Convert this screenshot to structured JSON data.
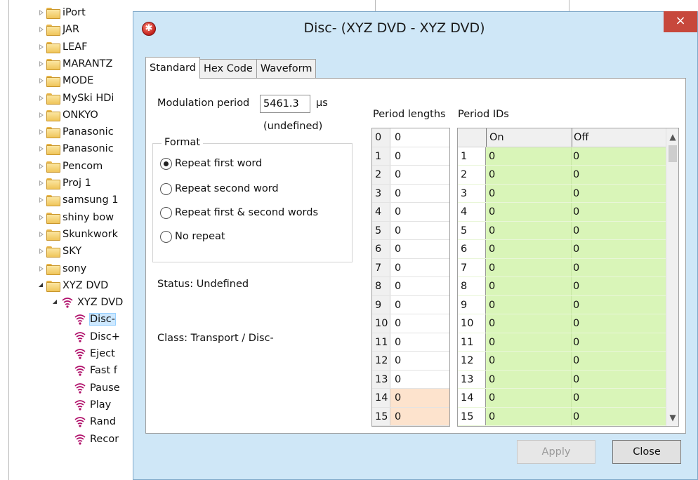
{
  "tree": {
    "items": [
      {
        "label": "iPort"
      },
      {
        "label": "JAR"
      },
      {
        "label": "LEAF"
      },
      {
        "label": "MARANTZ"
      },
      {
        "label": "MODE"
      },
      {
        "label": "MySki HDi"
      },
      {
        "label": "ONKYO"
      },
      {
        "label": "Panasonic"
      },
      {
        "label": "Panasonic"
      },
      {
        "label": "Pencom"
      },
      {
        "label": "Proj 1"
      },
      {
        "label": "samsung 1"
      },
      {
        "label": "shiny bow"
      },
      {
        "label": "Skunkwork"
      },
      {
        "label": "SKY"
      },
      {
        "label": "sony"
      },
      {
        "label": "XYZ DVD"
      },
      {
        "label": "XYZ DVD"
      },
      {
        "label": "Disc-"
      },
      {
        "label": "Disc+"
      },
      {
        "label": "Eject"
      },
      {
        "label": "Fast f"
      },
      {
        "label": "Pause"
      },
      {
        "label": "Play"
      },
      {
        "label": "Rand"
      },
      {
        "label": "Recor"
      }
    ]
  },
  "dialog": {
    "title": "Disc- (XYZ DVD - XYZ DVD)",
    "close_glyph": "×",
    "tabs": [
      {
        "label": "Standard",
        "active": true
      },
      {
        "label": "Hex Code",
        "active": false
      },
      {
        "label": "Waveform",
        "active": false
      }
    ],
    "modulation_label": "Modulation period",
    "modulation_value": "5461.3",
    "modulation_unit": "μs",
    "modulation_status": "(undefined)",
    "format": {
      "legend": "Format",
      "options": [
        {
          "label": "Repeat first word",
          "checked": true
        },
        {
          "label": "Repeat second word",
          "checked": false
        },
        {
          "label": "Repeat first & second words",
          "checked": false
        },
        {
          "label": "No repeat",
          "checked": false
        }
      ]
    },
    "status": "Status: Undefined",
    "class": "Class: Transport / Disc-",
    "period_lengths": {
      "title": "Period lengths",
      "rows": [
        {
          "idx": "0",
          "val": "0"
        },
        {
          "idx": "1",
          "val": "0"
        },
        {
          "idx": "2",
          "val": "0"
        },
        {
          "idx": "3",
          "val": "0"
        },
        {
          "idx": "4",
          "val": "0"
        },
        {
          "idx": "5",
          "val": "0"
        },
        {
          "idx": "6",
          "val": "0"
        },
        {
          "idx": "7",
          "val": "0"
        },
        {
          "idx": "8",
          "val": "0"
        },
        {
          "idx": "9",
          "val": "0"
        },
        {
          "idx": "10",
          "val": "0"
        },
        {
          "idx": "11",
          "val": "0"
        },
        {
          "idx": "12",
          "val": "0"
        },
        {
          "idx": "13",
          "val": "0"
        },
        {
          "idx": "14",
          "val": "0"
        },
        {
          "idx": "15",
          "val": "0"
        }
      ]
    },
    "period_ids": {
      "title": "Period IDs",
      "col_on": "On",
      "col_off": "Off",
      "rows": [
        {
          "idx": "1",
          "on": "0",
          "off": "0"
        },
        {
          "idx": "2",
          "on": "0",
          "off": "0"
        },
        {
          "idx": "3",
          "on": "0",
          "off": "0"
        },
        {
          "idx": "4",
          "on": "0",
          "off": "0"
        },
        {
          "idx": "5",
          "on": "0",
          "off": "0"
        },
        {
          "idx": "6",
          "on": "0",
          "off": "0"
        },
        {
          "idx": "7",
          "on": "0",
          "off": "0"
        },
        {
          "idx": "8",
          "on": "0",
          "off": "0"
        },
        {
          "idx": "9",
          "on": "0",
          "off": "0"
        },
        {
          "idx": "10",
          "on": "0",
          "off": "0"
        },
        {
          "idx": "11",
          "on": "0",
          "off": "0"
        },
        {
          "idx": "12",
          "on": "0",
          "off": "0"
        },
        {
          "idx": "13",
          "on": "0",
          "off": "0"
        },
        {
          "idx": "14",
          "on": "0",
          "off": "0"
        },
        {
          "idx": "15",
          "on": "0",
          "off": "0"
        }
      ]
    },
    "buttons": {
      "apply": "Apply",
      "close": "Close"
    }
  },
  "colors": {
    "dialog_bg": "#cfe7f7",
    "close_button": "#c7483c",
    "id_cell_green": "#d9f5b8",
    "highlight_peach": "#fde3cd"
  }
}
